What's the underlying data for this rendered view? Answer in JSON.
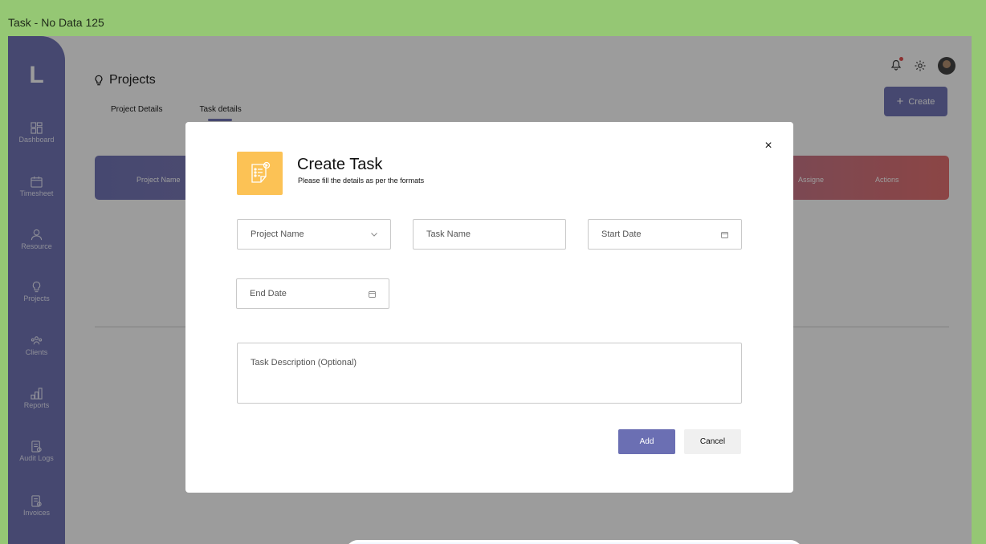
{
  "window": {
    "title": "Task - No Data 125"
  },
  "sidebar": {
    "logo": "L",
    "items": [
      {
        "label": "Dashboard",
        "icon": "dashboard-icon"
      },
      {
        "label": "Timesheet",
        "icon": "calendar-icon"
      },
      {
        "label": "Resource",
        "icon": "user-icon"
      },
      {
        "label": "Projects",
        "icon": "bulb-icon"
      },
      {
        "label": "Clients",
        "icon": "clients-icon"
      },
      {
        "label": "Reports",
        "icon": "reports-icon"
      },
      {
        "label": "Audit Logs",
        "icon": "audit-icon"
      },
      {
        "label": "Invoices",
        "icon": "invoice-icon"
      }
    ]
  },
  "header": {
    "title": "Projects",
    "tabs": [
      {
        "label": "Project Details"
      },
      {
        "label": "Task details"
      }
    ],
    "create_label": "Create"
  },
  "table": {
    "headers": [
      "Project Name",
      "Assigne",
      "Actions"
    ]
  },
  "modal": {
    "title": "Create Task",
    "subtitle": "Please fill the details as per the formats",
    "fields": {
      "project_name": "Project Name",
      "task_name": "Task Name",
      "start_date": "Start Date",
      "end_date": "End Date",
      "description": "Task Description (Optional)"
    },
    "add_label": "Add",
    "cancel_label": "Cancel",
    "close_symbol": "×"
  },
  "colors": {
    "accent": "#6b6fb3",
    "icon_bg": "#fcc255",
    "header_end": "#e36a6a",
    "backdrop": "#95c774"
  }
}
